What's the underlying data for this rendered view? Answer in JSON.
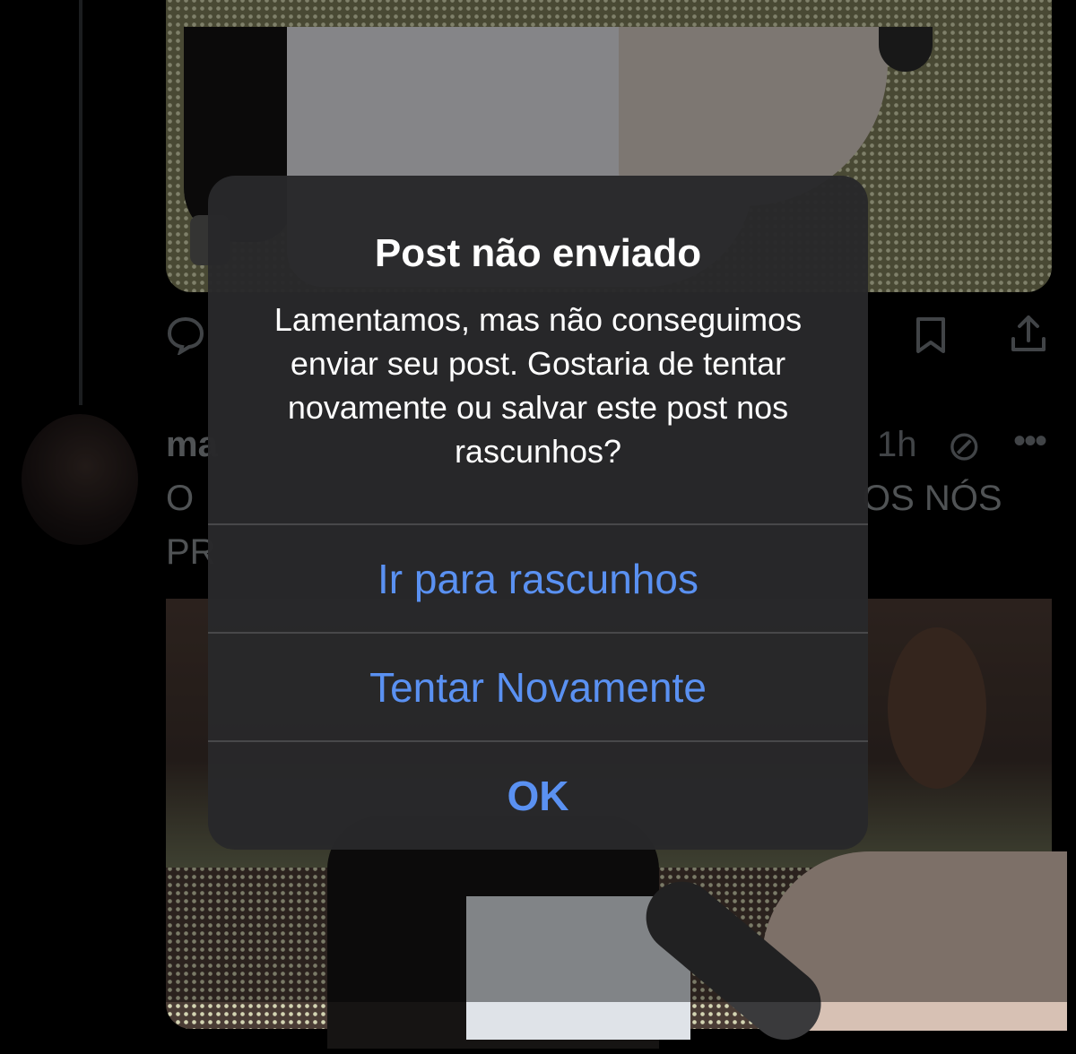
{
  "feed": {
    "tweet": {
      "name_visible": "ma",
      "time": "1h",
      "line1_start": "O",
      "line1_end": "OS NÓS",
      "line2_start": "PR"
    },
    "icons": {
      "reply": "reply-icon",
      "bookmark": "bookmark-icon",
      "share": "share-icon",
      "grok": "grok-icon",
      "more": "more-icon"
    }
  },
  "alert": {
    "title": "Post não enviado",
    "message": "Lamentamos, mas não conseguimos enviar seu post. Gostaria de tentar novamente ou salvar este post nos rascunhos?",
    "buttons": {
      "drafts": "Ir para rascunhos",
      "retry": "Tentar Novamente",
      "ok": "OK"
    },
    "button_color": "#5a91f2"
  }
}
